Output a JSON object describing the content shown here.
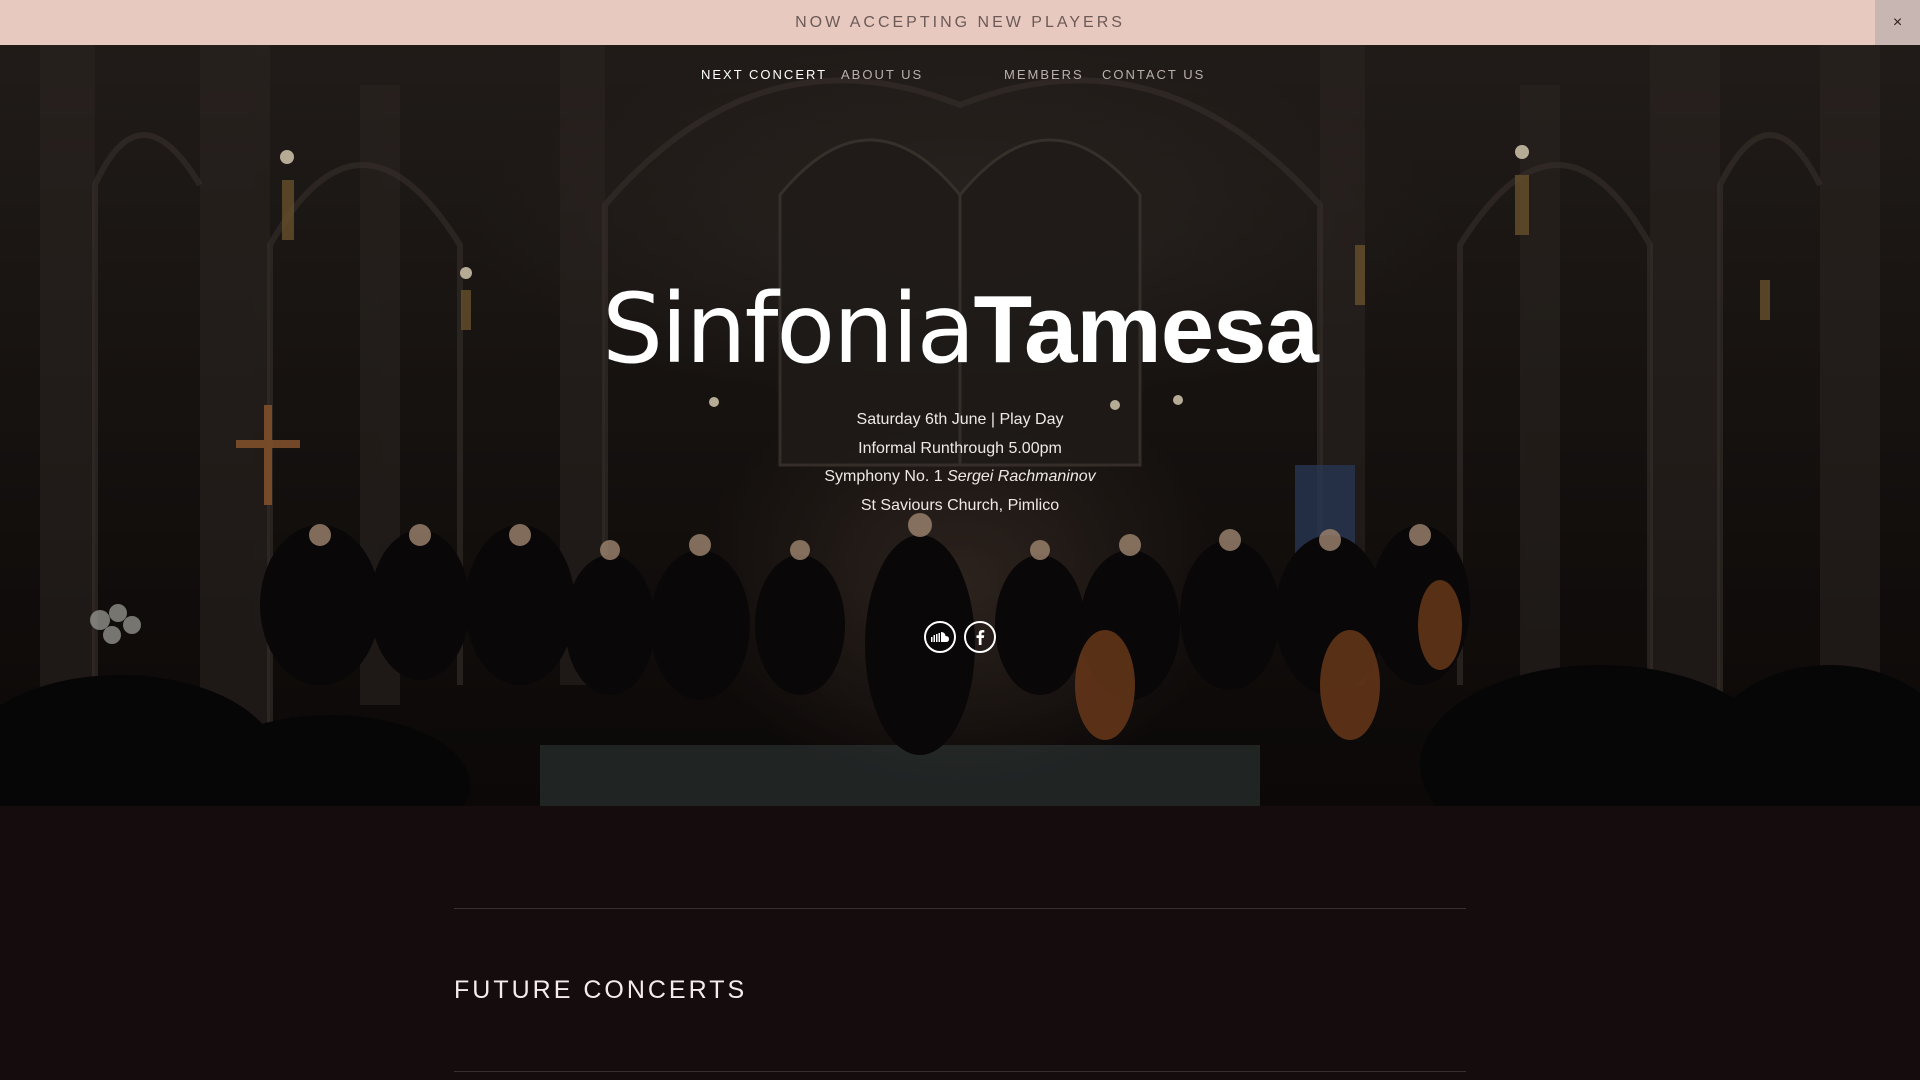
{
  "announcement": {
    "text": "NOW ACCEPTING NEW PLAYERS",
    "close_label": "×"
  },
  "nav": {
    "items": [
      {
        "label": "NEXT CONCERT",
        "active": true
      },
      {
        "label": "ABOUT US",
        "active": false
      },
      {
        "label": "MEMBERS",
        "active": false
      },
      {
        "label": "CONTACT US",
        "active": false
      }
    ]
  },
  "hero": {
    "title_light": "Sinfonia",
    "title_bold": "Tamesa",
    "line1": "Saturday 6th June |  Play Day",
    "line2": "Informal Runthrough 5.00pm",
    "line3_work": "Symphony No. 1 ",
    "line3_composer": "Sergei Rachmaninov",
    "line4": "St Saviours Church, Pimlico",
    "social": [
      {
        "icon": "soundcloud-icon"
      },
      {
        "icon": "facebook-icon"
      }
    ]
  },
  "sections": {
    "future_title": "FUTURE CONCERTS"
  },
  "colors": {
    "announcement_bg": "#e8c9bf",
    "page_bg": "#150c0e"
  }
}
